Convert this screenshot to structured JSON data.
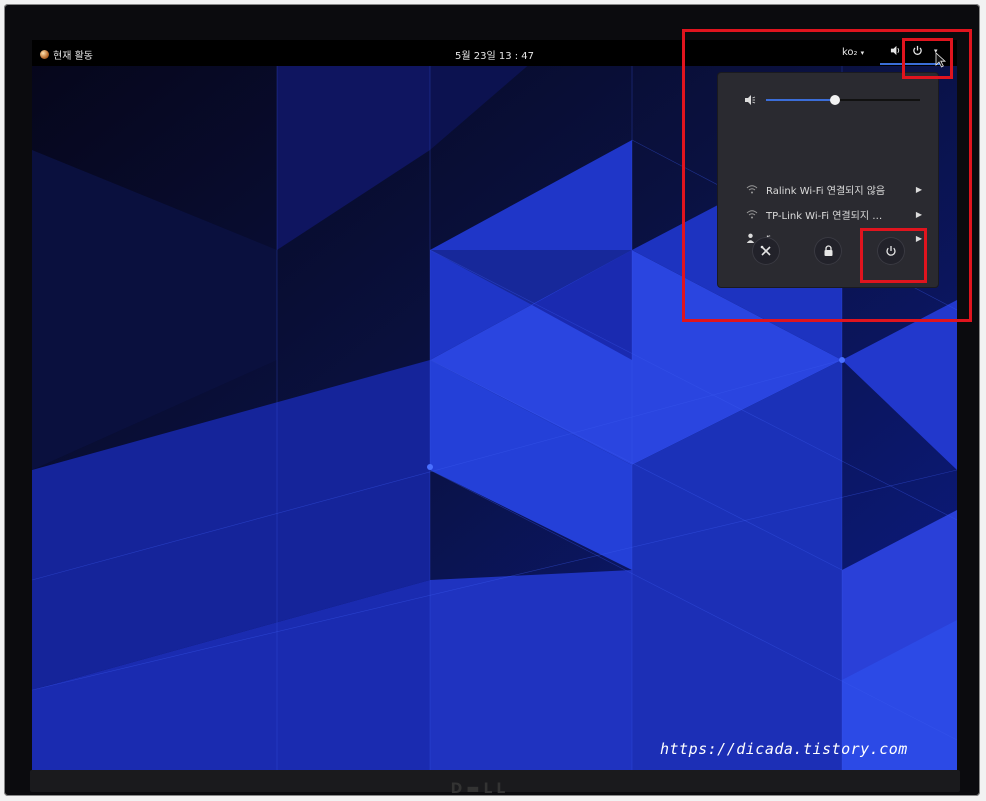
{
  "topbar": {
    "activities_label": "현재 활동",
    "clock": "5월 23일  13 : 47",
    "input_source": "ko₂",
    "input_source_arrow": "▾",
    "menu_arrow": "▾"
  },
  "sys_menu": {
    "volume_percent": 45,
    "items": [
      {
        "label": "Ralink Wi-Fi 연결되지 않음",
        "icon": "wifi-icon"
      },
      {
        "label": "TP-Link Wi-Fi 연결되지 …",
        "icon": "wifi-icon"
      },
      {
        "label": "r",
        "icon": "user-icon"
      }
    ],
    "submenu_arrow": "▶",
    "actions": [
      {
        "name": "settings",
        "icon": "settings-icon"
      },
      {
        "name": "lock",
        "icon": "lock-icon"
      },
      {
        "name": "power",
        "icon": "power-icon"
      }
    ]
  },
  "watermark": "https://dicada.tistory.com",
  "colors": {
    "accent": "#3b6dd8",
    "annotation": "#e0141e",
    "menu_bg": "#2a2a30",
    "topbar_bg": "#000000"
  }
}
